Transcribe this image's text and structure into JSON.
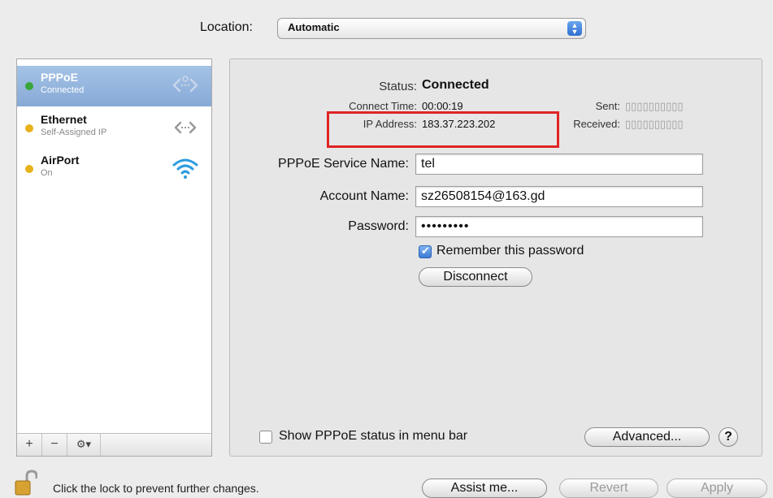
{
  "location": {
    "label": "Location:",
    "value": "Automatic"
  },
  "services": [
    {
      "name": "PPPoE",
      "status": "Connected",
      "dot_color": "#3aa63a",
      "icon": "ppp-arrows-icon",
      "selected": true
    },
    {
      "name": "Ethernet",
      "status": "Self-Assigned IP",
      "dot_color": "#e7b21a",
      "icon": "ethernet-arrows-icon",
      "selected": false
    },
    {
      "name": "AirPort",
      "status": "On",
      "dot_color": "#e7b21a",
      "icon": "wifi-icon",
      "selected": false
    }
  ],
  "sidebar_toolbar": {
    "add": "+",
    "remove": "−",
    "actions": "⚙▾"
  },
  "status": {
    "status_label": "Status:",
    "status_value": "Connected",
    "connect_time_label": "Connect Time:",
    "connect_time_value": "00:00:19",
    "ip_label": "IP Address:",
    "ip_value": "183.37.223.202",
    "sent_label": "Sent:",
    "sent_value": "▯▯▯▯▯▯▯▯▯▯",
    "received_label": "Received:",
    "received_value": "▯▯▯▯▯▯▯▯▯▯"
  },
  "form": {
    "service_name_label": "PPPoE Service Name:",
    "service_name_value": "tel",
    "account_label": "Account Name:",
    "account_value": "sz26508154@163.gd",
    "password_label": "Password:",
    "password_value": "•••••••••",
    "remember_label": "Remember this password",
    "remember_checked": true,
    "disconnect_label": "Disconnect"
  },
  "footer_panel": {
    "show_status_label": "Show PPPoE status in menu bar",
    "advanced_label": "Advanced...",
    "help_label": "?"
  },
  "bottom": {
    "lock_text": "Click the lock to prevent further changes.",
    "assist_label": "Assist me...",
    "revert_label": "Revert",
    "apply_label": "Apply"
  },
  "colors": {
    "highlight": "#e02424",
    "selection": "#93b4dd"
  }
}
